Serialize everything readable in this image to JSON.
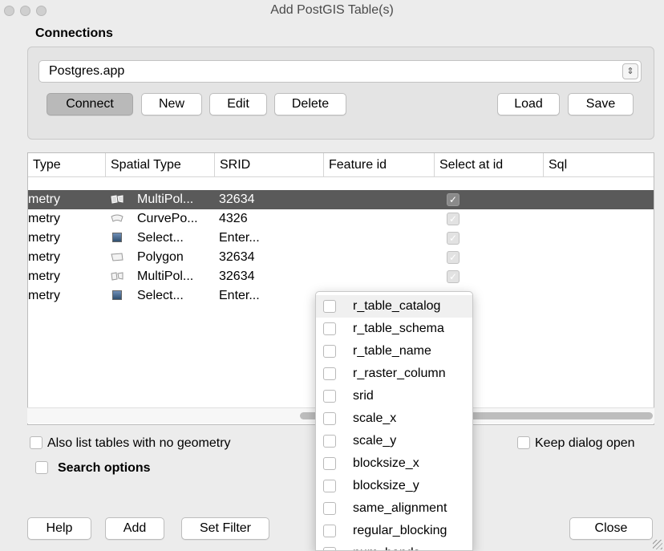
{
  "window": {
    "title": "Add PostGIS Table(s)"
  },
  "connections": {
    "group_title": "Connections",
    "selected": "Postgres.app",
    "buttons": {
      "connect": "Connect",
      "new": "New",
      "edit": "Edit",
      "delete": "Delete",
      "load": "Load",
      "save": "Save"
    }
  },
  "table": {
    "headers": [
      "Type",
      "Spatial Type",
      "SRID",
      "Feature id",
      "Select at id",
      "Sql"
    ],
    "rows": [
      {
        "type": "metry",
        "spatial_type": "MultiPol...",
        "icon": "multipolygon-icon",
        "srid": "32634",
        "select_at_id": true,
        "selected": true
      },
      {
        "type": "metry",
        "spatial_type": "CurvePo...",
        "icon": "curvepolygon-icon",
        "srid": "4326",
        "select_at_id": true,
        "selected": false
      },
      {
        "type": "metry",
        "spatial_type": "Select...",
        "icon": "raster-icon",
        "srid": "Enter...",
        "select_at_id": true,
        "selected": false
      },
      {
        "type": "metry",
        "spatial_type": "Polygon",
        "icon": "polygon-icon",
        "srid": "32634",
        "select_at_id": true,
        "selected": false
      },
      {
        "type": "metry",
        "spatial_type": "MultiPol...",
        "icon": "multipolygon-icon",
        "srid": "32634",
        "select_at_id": true,
        "selected": false
      },
      {
        "type": "metry",
        "spatial_type": "Select...",
        "icon": "raster-icon",
        "srid": "Enter...",
        "select_at_id": false,
        "selected": false
      }
    ]
  },
  "options": {
    "also_list": "Also list tables with no geometry",
    "search_options": "Search options",
    "keep_open": "Keep dialog open"
  },
  "footer": {
    "help": "Help",
    "add": "Add",
    "set_filter": "Set Filter",
    "close": "Close"
  },
  "popup": {
    "items": [
      "r_table_catalog",
      "r_table_schema",
      "r_table_name",
      "r_raster_column",
      "srid",
      "scale_x",
      "scale_y",
      "blocksize_x",
      "blocksize_y",
      "same_alignment",
      "regular_blocking",
      "num_bands"
    ]
  },
  "colors": {
    "selected_row": "#5a5a5a",
    "window_bg": "#ececec"
  }
}
